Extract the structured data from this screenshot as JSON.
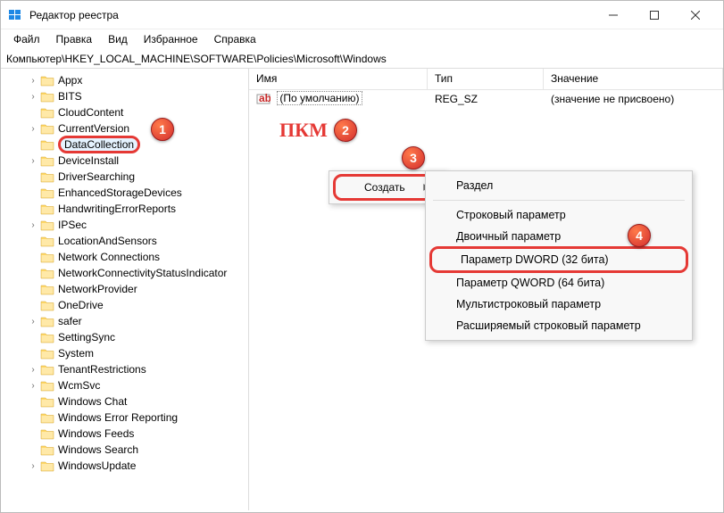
{
  "window": {
    "title": "Редактор реестра"
  },
  "menubar": {
    "file": "Файл",
    "edit": "Правка",
    "view": "Вид",
    "favorites": "Избранное",
    "help": "Справка"
  },
  "addressbar": {
    "path": "Компьютер\\HKEY_LOCAL_MACHINE\\SOFTWARE\\Policies\\Microsoft\\Windows"
  },
  "tree": {
    "items": [
      {
        "label": "Appx",
        "expandable": true
      },
      {
        "label": "BITS",
        "expandable": true
      },
      {
        "label": "CloudContent",
        "expandable": false
      },
      {
        "label": "CurrentVersion",
        "expandable": true
      },
      {
        "label": "DataCollection",
        "expandable": false,
        "selected": true,
        "highlighted": true
      },
      {
        "label": "DeviceInstall",
        "expandable": true
      },
      {
        "label": "DriverSearching",
        "expandable": false
      },
      {
        "label": "EnhancedStorageDevices",
        "expandable": false
      },
      {
        "label": "HandwritingErrorReports",
        "expandable": false
      },
      {
        "label": "IPSec",
        "expandable": true
      },
      {
        "label": "LocationAndSensors",
        "expandable": false
      },
      {
        "label": "Network Connections",
        "expandable": false
      },
      {
        "label": "NetworkConnectivityStatusIndicator",
        "expandable": false
      },
      {
        "label": "NetworkProvider",
        "expandable": false
      },
      {
        "label": "OneDrive",
        "expandable": false
      },
      {
        "label": "safer",
        "expandable": true
      },
      {
        "label": "SettingSync",
        "expandable": false
      },
      {
        "label": "System",
        "expandable": false
      },
      {
        "label": "TenantRestrictions",
        "expandable": true
      },
      {
        "label": "WcmSvc",
        "expandable": true
      },
      {
        "label": "Windows Chat",
        "expandable": false
      },
      {
        "label": "Windows Error Reporting",
        "expandable": false
      },
      {
        "label": "Windows Feeds",
        "expandable": false
      },
      {
        "label": "Windows Search",
        "expandable": false
      },
      {
        "label": "WindowsUpdate",
        "expandable": true
      }
    ]
  },
  "list": {
    "headers": {
      "name": "Имя",
      "type": "Тип",
      "value": "Значение"
    },
    "rows": [
      {
        "name": "(По умолчанию)",
        "type": "REG_SZ",
        "value": "(значение не присвоено)"
      }
    ]
  },
  "context": {
    "create": "Создать",
    "submenu": {
      "key": "Раздел",
      "string": "Строковый параметр",
      "binary": "Двоичный параметр",
      "dword": "Параметр DWORD (32 бита)",
      "qword": "Параметр QWORD (64 бита)",
      "multi": "Мультистроковый параметр",
      "expand": "Расширяемый строковый параметр"
    }
  },
  "annotations": {
    "rbm": "ПКМ",
    "badge1": "1",
    "badge2": "2",
    "badge3": "3",
    "badge4": "4"
  }
}
